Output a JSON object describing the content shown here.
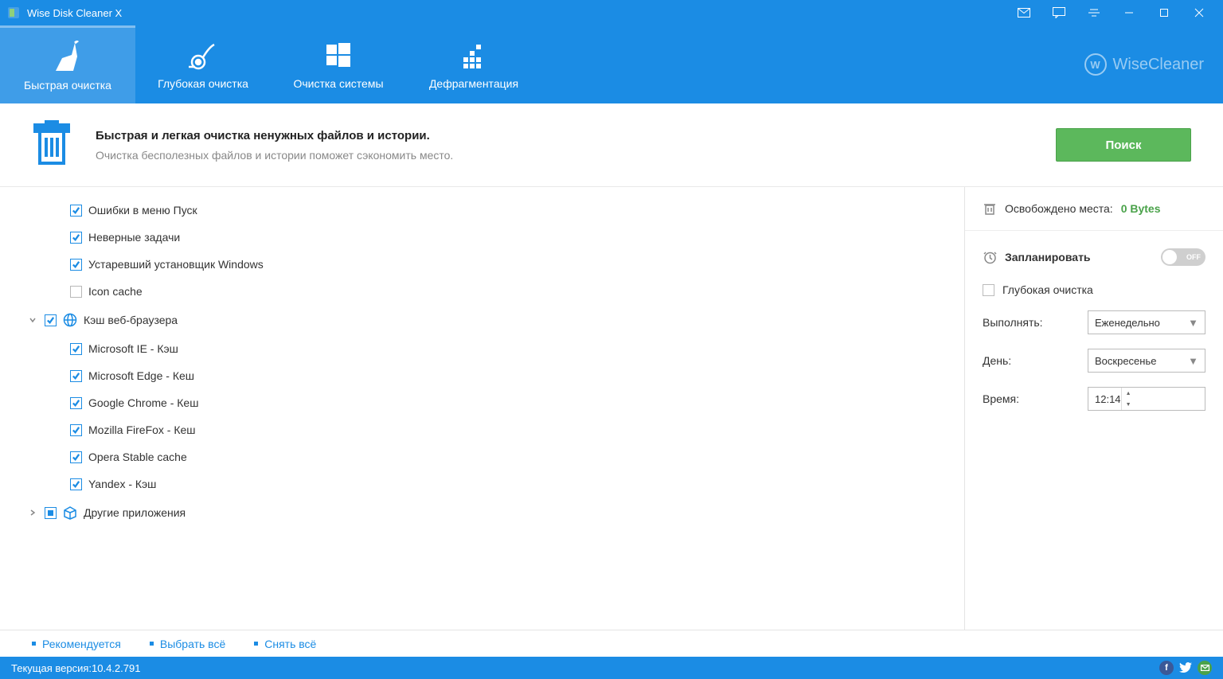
{
  "app": {
    "title": "Wise Disk Cleaner X",
    "brand": "WiseCleaner"
  },
  "tabs": [
    {
      "label": "Быстрая очистка"
    },
    {
      "label": "Глубокая очистка"
    },
    {
      "label": "Очистка системы"
    },
    {
      "label": "Дефрагментация"
    }
  ],
  "headline": {
    "title": "Быстрая и легкая очистка ненужных файлов и истории.",
    "subtitle": "Очистка бесполезных файлов и истории поможет сэкономить место.",
    "button": "Поиск"
  },
  "tree": {
    "items": [
      {
        "label": "Ошибки в меню Пуск",
        "checked": true
      },
      {
        "label": "Неверные задачи",
        "checked": true
      },
      {
        "label": "Устаревший установщик Windows",
        "checked": true
      },
      {
        "label": "Icon cache",
        "checked": false
      }
    ],
    "browserCategory": {
      "label": "Кэш веб-браузера"
    },
    "browsers": [
      {
        "label": "Microsoft IE - Кэш"
      },
      {
        "label": "Microsoft Edge - Кеш"
      },
      {
        "label": "Google Chrome - Кеш"
      },
      {
        "label": "Mozilla FireFox - Кеш"
      },
      {
        "label": "Opera Stable cache"
      },
      {
        "label": "Yandex - Кэш"
      }
    ],
    "otherCategory": {
      "label": "Другие приложения"
    }
  },
  "right": {
    "freed_label": "Освобождено места:",
    "freed_value": "0 Bytes",
    "schedule_label": "Запланировать",
    "toggle_text": "OFF",
    "deep_label": "Глубокая очистка",
    "run_label": "Выполнять:",
    "run_value": "Еженедельно",
    "day_label": "День:",
    "day_value": "Воскресенье",
    "time_label": "Время:",
    "time_value": "12:14"
  },
  "actions": {
    "recommended": "Рекомендуется",
    "select_all": "Выбрать всё",
    "deselect_all": "Снять всё"
  },
  "status": {
    "version_label": "Текущая версия:",
    "version_value": "10.4.2.791"
  }
}
